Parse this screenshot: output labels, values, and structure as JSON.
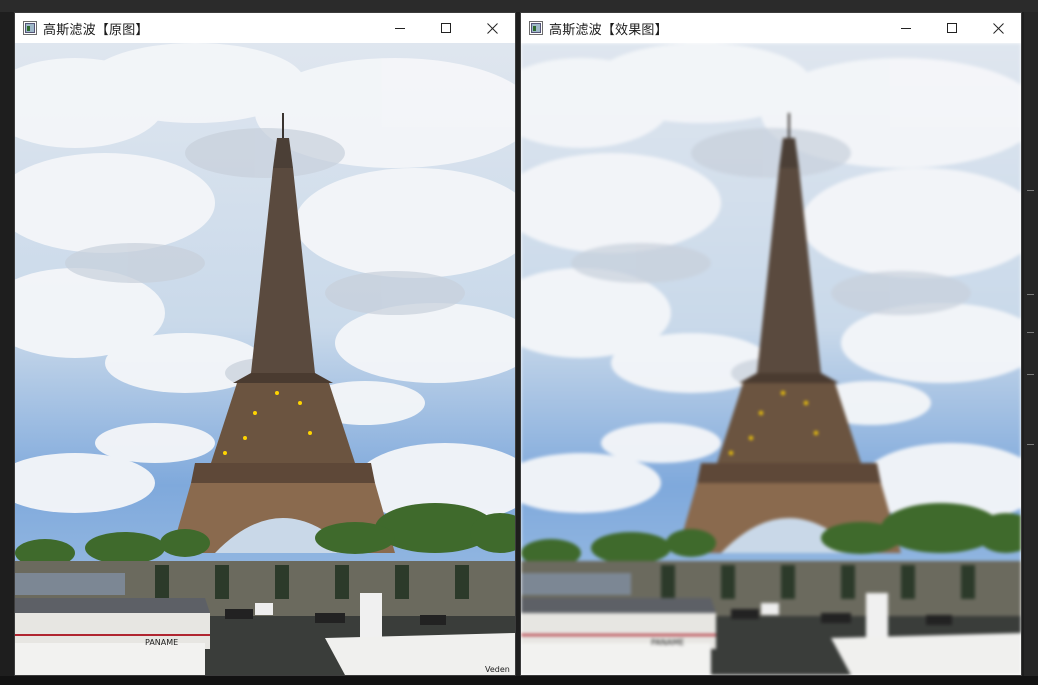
{
  "windows": [
    {
      "title": "高斯滤波【原图】",
      "image_alt": "Eiffel Tower under cloudy blue sky with boats on the Seine (original)"
    },
    {
      "title": "高斯滤波【效果图】",
      "image_alt": "Eiffel Tower under cloudy blue sky with boats on the Seine (Gaussian blurred)"
    }
  ],
  "boat_name": "PANAME",
  "boat2_text": "Veden",
  "icons": {
    "minimize": "minimize-icon",
    "maximize": "maximize-icon",
    "close": "close-icon",
    "app": "app-window-icon"
  }
}
